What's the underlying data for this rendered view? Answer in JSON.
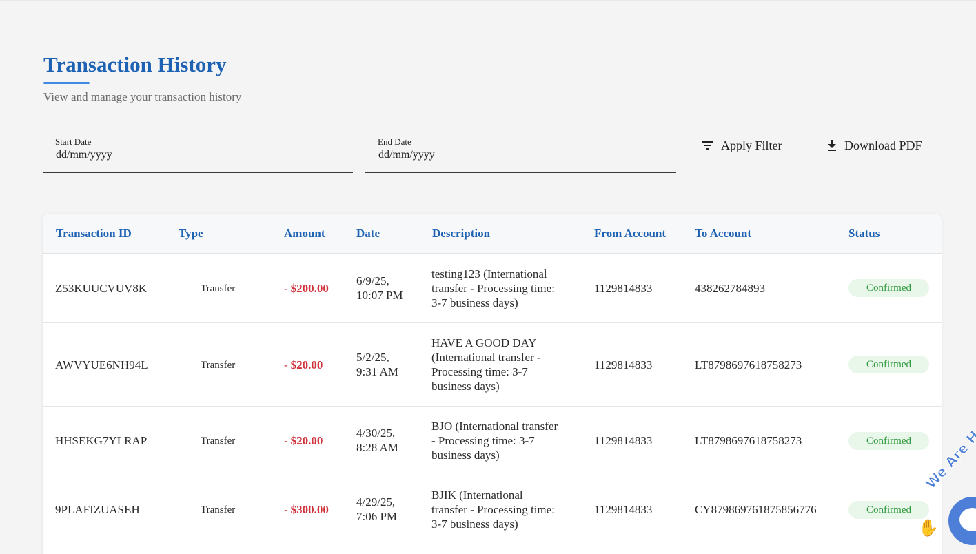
{
  "header": {
    "title": "Transaction History",
    "subtitle": "View and manage your transaction history"
  },
  "filters": {
    "start_date": {
      "label": "Start Date",
      "value": "dd/mm/yyyy"
    },
    "end_date": {
      "label": "End Date",
      "value": "dd/mm/yyyy"
    },
    "apply_label": "Apply Filter",
    "download_label": "Download PDF"
  },
  "table": {
    "columns": [
      "Transaction ID",
      "Type",
      "Amount",
      "Date",
      "Description",
      "From Account",
      "To Account",
      "Status"
    ],
    "rows": [
      {
        "id": "Z53KUUCVUV8K",
        "type": "Transfer",
        "amount": "$200.00",
        "date": [
          "6/9/25,",
          "10:07 PM"
        ],
        "description": [
          "testing123 (International",
          "transfer - Processing time:",
          "3-7 business days)"
        ],
        "from": "1129814833",
        "to": "438262784893",
        "status": "Confirmed"
      },
      {
        "id": "AWVYUE6NH94L",
        "type": "Transfer",
        "amount": "$20.00",
        "date": [
          "5/2/25,",
          "9:31 AM"
        ],
        "description": [
          "HAVE A GOOD DAY",
          "(International transfer -",
          "Processing time: 3-7",
          "business days)"
        ],
        "from": "1129814833",
        "to": "LT8798697618758273",
        "status": "Confirmed"
      },
      {
        "id": "HHSEKG7YLRAP",
        "type": "Transfer",
        "amount": "$20.00",
        "date": [
          "4/30/25,",
          "8:28 AM"
        ],
        "description": [
          "BJO (International transfer",
          "- Processing time: 3-7",
          "business days)"
        ],
        "from": "1129814833",
        "to": "LT8798697618758273",
        "status": "Confirmed"
      },
      {
        "id": "9PLAFIZUASEH",
        "type": "Transfer",
        "amount": "$300.00",
        "date": [
          "4/29/25,",
          "7:06 PM"
        ],
        "description": [
          "BJIK (International",
          "transfer - Processing time:",
          "3-7 business days)"
        ],
        "from": "1129814833",
        "to": "CY879869761875856776",
        "status": "Confirmed"
      }
    ]
  },
  "chat_widget": {
    "text": "We Are H"
  },
  "colors": {
    "accent": "#1e62b4",
    "amount_negative": "#d0323c",
    "status_confirmed_bg": "#e9f6ea",
    "status_confirmed_text": "#2e9a3e",
    "chat": "#4d7fd8"
  },
  "icons": {
    "apply": "filter-icon",
    "download": "download-icon",
    "chat": "chat-icon"
  }
}
